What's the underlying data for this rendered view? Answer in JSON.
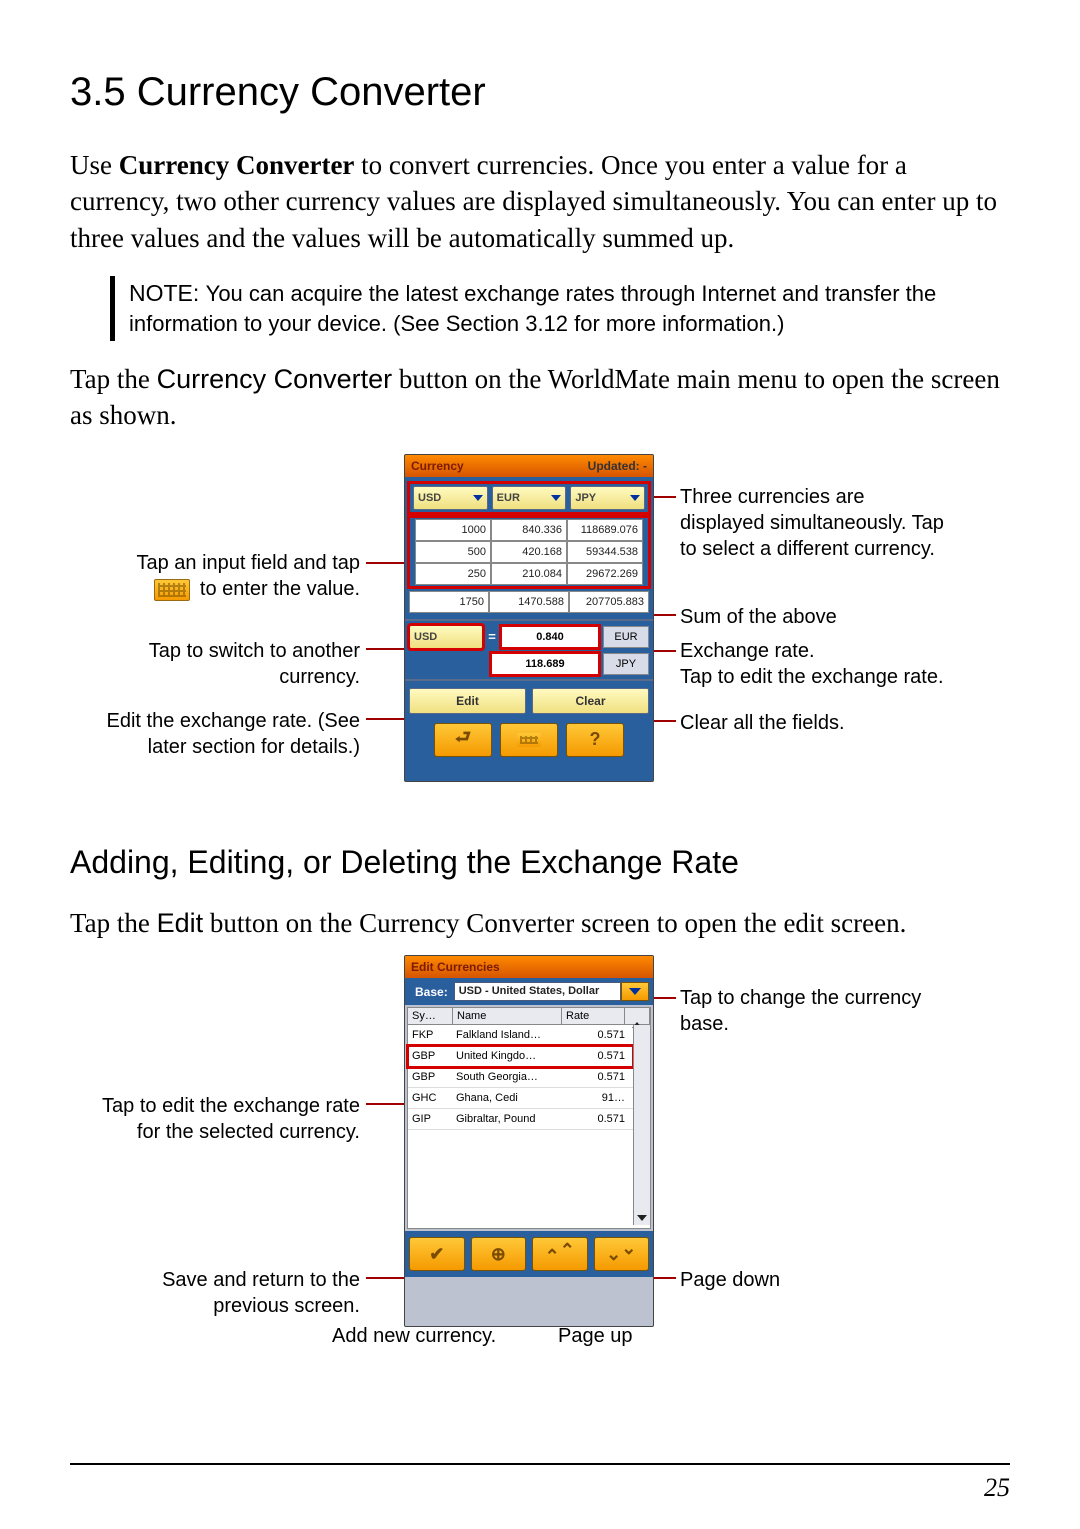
{
  "heading": "3.5    Currency Converter",
  "intro_pre": "Use ",
  "intro_bold": "Currency Converter",
  "intro_post": " to convert currencies. Once you enter a value for a currency, two other currency values are displayed simultaneously. You can enter up to three values and the values will be automatically summed up.",
  "note_label": "NOTE: ",
  "note_text": "You can acquire the latest exchange rates through Internet and transfer the information to your device. (See Section 3.12 for more information.)",
  "para2_pre": "Tap the ",
  "para2_btn": "Currency Converter",
  "para2_post": " button on the WorldMate main menu to open the screen as shown.",
  "fig1": {
    "titlebar_left": "Currency",
    "titlebar_right": "Updated:      -",
    "dropdowns": [
      "USD",
      "EUR",
      "JPY"
    ],
    "rows": [
      [
        "1000",
        "840.336",
        "118689.076"
      ],
      [
        "500",
        "420.168",
        "59344.538"
      ],
      [
        "250",
        "210.084",
        "29672.269"
      ]
    ],
    "sum": [
      "1750",
      "1470.588",
      "207705.883"
    ],
    "rate_from": "USD",
    "rate_eur_val": "0.840",
    "rate_eur_lbl": "EUR",
    "rate_jpy_val": "118.689",
    "rate_jpy_lbl": "JPY",
    "edit_btn": "Edit",
    "clear_btn": "Clear",
    "callouts_left": {
      "input": "Tap an input field and tap",
      "input2": "to enter the value.",
      "switch": "Tap to switch to another currency.",
      "edit": "Edit the exchange rate. (See later section for details.)"
    },
    "callouts_right": {
      "three": "Three currencies are displayed simultaneously. Tap to select a different currency.",
      "sum": "Sum of the above",
      "rate": "Exchange rate.\nTap to edit the exchange rate.",
      "clear": "Clear all the fields."
    }
  },
  "subheading": "Adding, Editing, or Deleting the Exchange Rate",
  "para3_pre": "Tap the ",
  "para3_btn": "Edit",
  "para3_post": " button on the Currency Converter screen to open the edit screen.",
  "fig2": {
    "titlebar": "Edit Currencies",
    "base_label": "Base:",
    "base_value": "USD - United States, Dollar",
    "cols": {
      "sy": "Sy…",
      "name": "Name",
      "rate": "Rate"
    },
    "rows": [
      {
        "sy": "FKP",
        "name": "Falkland Island…",
        "rate": "0.571"
      },
      {
        "sy": "GBP",
        "name": "United Kingdo…",
        "rate": "0.571"
      },
      {
        "sy": "GBP",
        "name": "South Georgia…",
        "rate": "0.571"
      },
      {
        "sy": "GHC",
        "name": "Ghana, Cedi",
        "rate": "91…"
      },
      {
        "sy": "GIP",
        "name": "Gibraltar, Pound",
        "rate": "0.571"
      }
    ],
    "callouts_left": {
      "editrate": "Tap to edit the exchange rate for the selected currency.",
      "save": "Save and return to the previous screen."
    },
    "callouts_right": {
      "base": "Tap to change the currency base.",
      "pagedown": "Page down"
    },
    "callouts_below": {
      "addnew": "Add new currency.",
      "pageup": "Page up"
    }
  },
  "page_number": "25"
}
